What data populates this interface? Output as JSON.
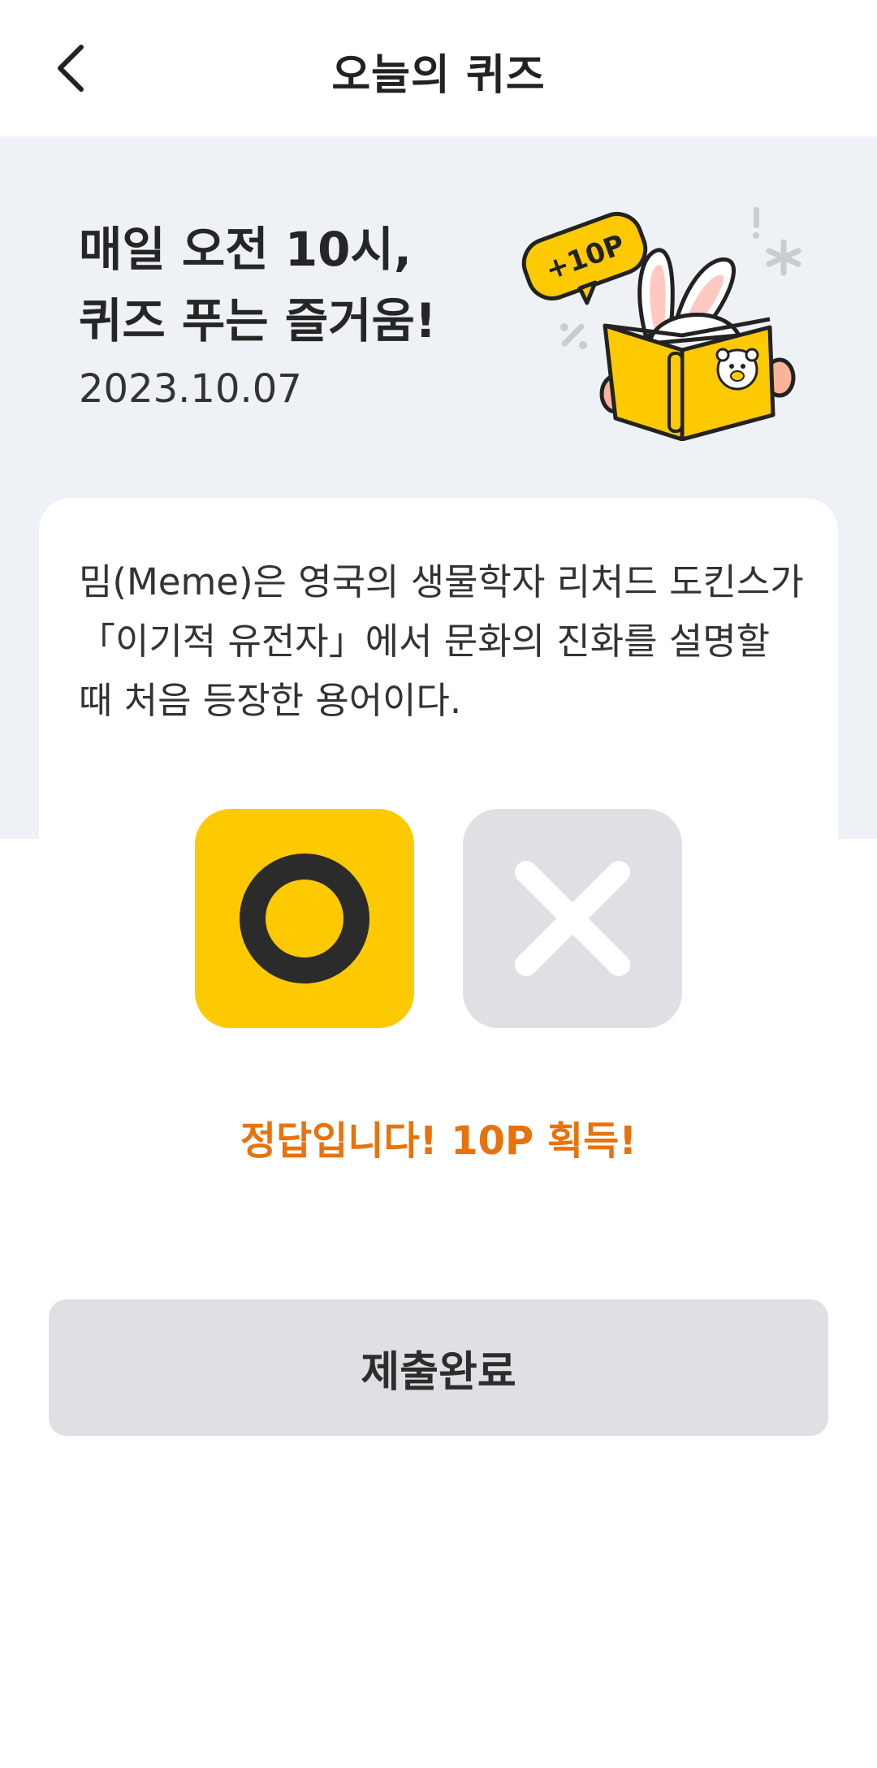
{
  "header": {
    "title": "오늘의 퀴즈",
    "back_icon": "chevron-left-icon"
  },
  "hero": {
    "title": "매일 오전 10시,\n퀴즈 푸는 즐거움!",
    "date": "2023.10.07",
    "badge": "+10P"
  },
  "quiz": {
    "question": "밈(Meme)은 영국의 생물학자 리처드 도킨스가 「이기적 유전자」에서 문화의 진화를 설명할 때 처음 등장한 용어이다.",
    "options": [
      {
        "label": "O",
        "icon": "circle-o-icon",
        "selected": true
      },
      {
        "label": "X",
        "icon": "cross-x-icon",
        "selected": false
      }
    ],
    "result": "정답입니다! 10P 획득!"
  },
  "submit": {
    "label": "제출완료"
  },
  "colors": {
    "accent_yellow": "#fdc900",
    "result_orange": "#e8720c",
    "hero_bg": "#eef1f5",
    "disabled_gray": "#dee0e3"
  }
}
